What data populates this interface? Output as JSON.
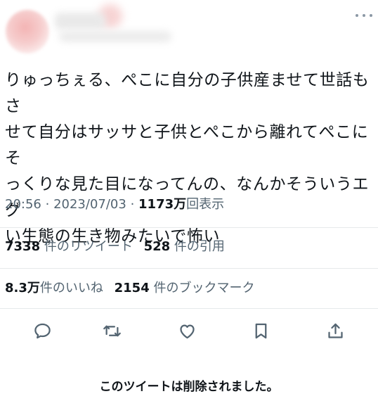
{
  "tweet": {
    "text": "りゅっちぇる、ぺこに自分の子供産ませて世話もさせて自分はサッサと子供とぺこから離れてぺこにそっくりな見た目になってんの、なんかそういうエグい生態の生き物みたいで怖い",
    "lines": [
      "りゅっちぇる、ぺこに自分の子供産ませて世話もさ",
      "せて自分はサッサと子供とぺこから離れてぺこにそ",
      "っくりな見た目になってんの、なんかそういうエグ",
      "い生態の生き物みたいで怖い"
    ],
    "time": "20:56",
    "separator": "·",
    "date": "2023/07/03",
    "views_count": "1173万",
    "views_label": "回表示"
  },
  "stats": {
    "retweets_count": "7338",
    "retweets_label": "件のリツイート",
    "quotes_count": "528",
    "quotes_label": "件の引用",
    "likes_count": "8.3万",
    "likes_label": "件のいいね",
    "bookmarks_count": "2154",
    "bookmarks_label": "件のブックマーク"
  },
  "icons": {
    "more": "more-icon",
    "reply": "reply-icon",
    "retweet": "retweet-icon",
    "like": "like-icon",
    "bookmark": "bookmark-icon",
    "share": "share-icon",
    "icon_color": "#536471"
  },
  "footer": {
    "deleted_notice": "このツイートは削除されました。"
  }
}
